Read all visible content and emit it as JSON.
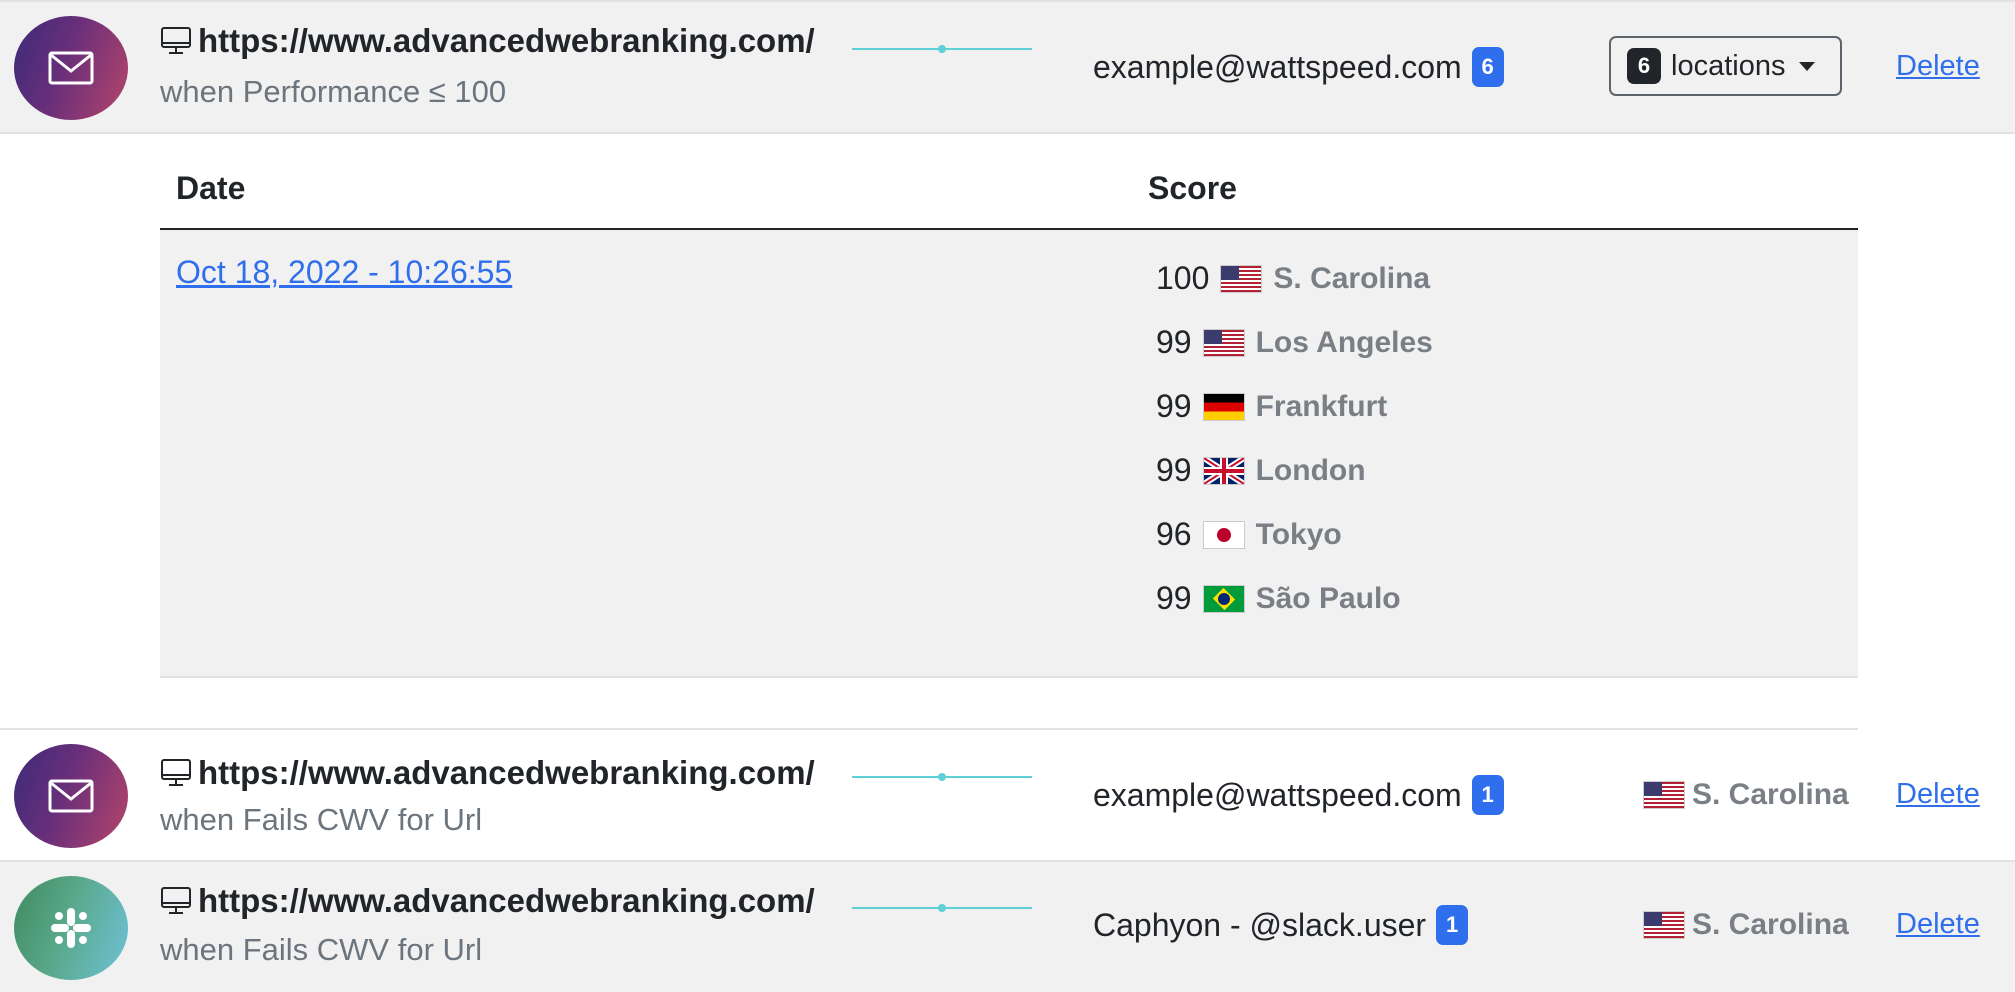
{
  "alerts": [
    {
      "channel_icon": "envelope-icon",
      "device_icon": "desktop-icon",
      "url": "https://www.advancedwebranking.com/",
      "condition": "when Performance ≤ 100",
      "recipient": "example@wattspeed.com",
      "recipient_count": "6",
      "locations_count": "6",
      "locations_label": "locations",
      "delete_label": "Delete"
    },
    {
      "channel_icon": "envelope-icon",
      "device_icon": "desktop-icon",
      "url": "https://www.advancedwebranking.com/",
      "condition": "when Fails CWV for Url",
      "recipient": "example@wattspeed.com",
      "recipient_count": "1",
      "location": "S. Carolina",
      "location_flag": "us-flag-icon",
      "delete_label": "Delete"
    },
    {
      "channel_icon": "slack-icon",
      "device_icon": "desktop-icon",
      "url": "https://www.advancedwebranking.com/",
      "condition": "when Fails CWV for Url",
      "recipient": "Caphyon - @slack.user",
      "recipient_count": "1",
      "location": "S. Carolina",
      "location_flag": "us-flag-icon",
      "delete_label": "Delete"
    }
  ],
  "detail": {
    "headers": {
      "date": "Date",
      "score": "Score"
    },
    "date": "Oct 18, 2022 - 10:26:55",
    "scores": [
      {
        "score": "100",
        "location": "S. Carolina",
        "flag": "us-flag-icon"
      },
      {
        "score": "99",
        "location": "Los Angeles",
        "flag": "us-flag-icon"
      },
      {
        "score": "99",
        "location": "Frankfurt",
        "flag": "de-flag-icon"
      },
      {
        "score": "99",
        "location": "London",
        "flag": "uk-flag-icon"
      },
      {
        "score": "96",
        "location": "Tokyo",
        "flag": "jp-flag-icon"
      },
      {
        "score": "99",
        "location": "São Paulo",
        "flag": "br-flag-icon"
      }
    ]
  },
  "colors": {
    "link_blue": "#2f6fed",
    "sparkline": "#5fd0d6",
    "row_shade": "#f1f1f1"
  }
}
